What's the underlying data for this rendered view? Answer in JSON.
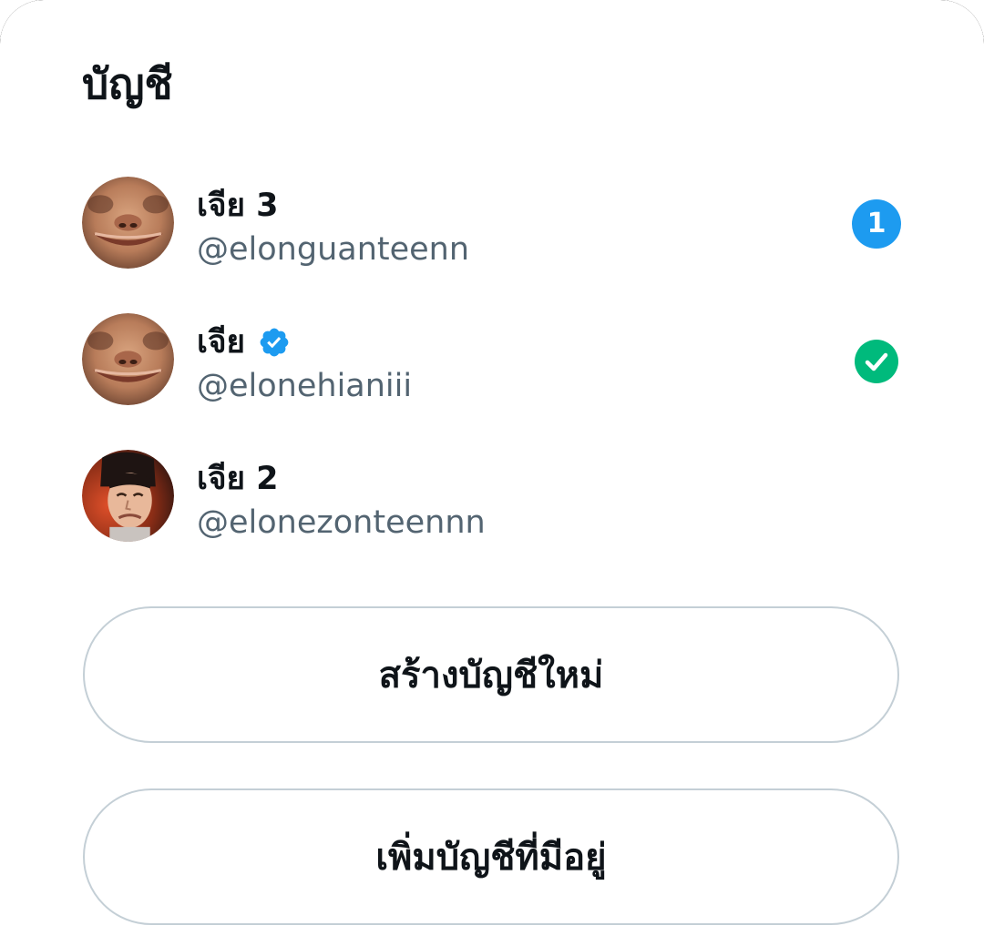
{
  "sheet": {
    "title": "บัญชี"
  },
  "accounts": [
    {
      "display_name": "เจีย 3",
      "handle": "@elonguanteenn",
      "verified": false,
      "notification_count": "1",
      "active": false,
      "avatar_icon": "face-avatar-stretched"
    },
    {
      "display_name": "เจีย",
      "handle": "@elonehianiii",
      "verified": true,
      "notification_count": null,
      "active": true,
      "avatar_icon": "face-avatar-stretched"
    },
    {
      "display_name": "เจีย 2",
      "handle": "@elonezonteennn",
      "verified": false,
      "notification_count": null,
      "active": false,
      "avatar_icon": "face-avatar-grimace"
    }
  ],
  "buttons": {
    "create_account_label": "สร้างบัญชีใหม่",
    "add_existing_label": "เพิ่มบัญชีที่มีอยู่"
  },
  "colors": {
    "accent_blue": "#1d9bf0",
    "active_green": "#00ba7c",
    "handle_gray": "#536471",
    "border_gray": "#c4cfd6",
    "text_primary": "#0f1419"
  }
}
